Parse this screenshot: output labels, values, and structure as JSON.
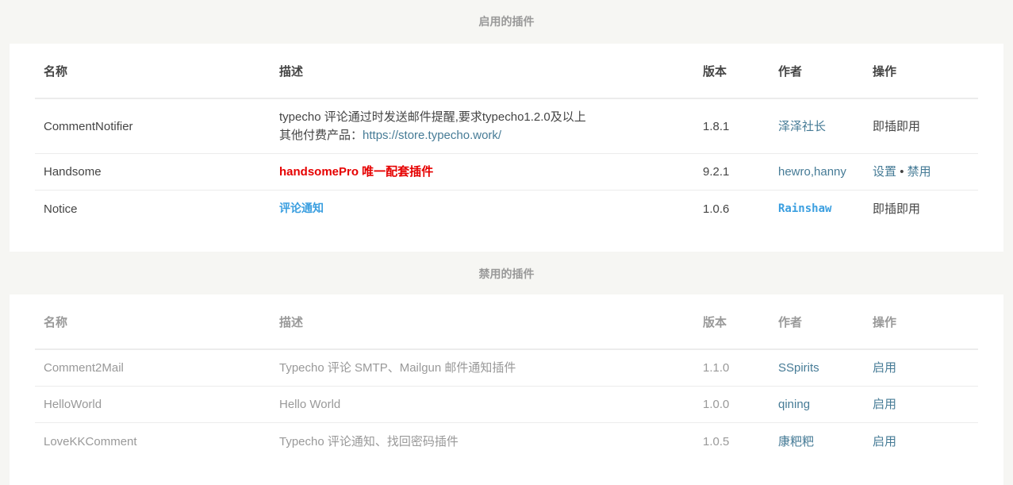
{
  "enabled": {
    "title": "启用的插件",
    "headers": {
      "name": "名称",
      "desc": "描述",
      "version": "版本",
      "author": "作者",
      "action": "操作"
    },
    "rows": [
      {
        "name": "CommentNotifier",
        "desc_line1": "typecho 评论通过时发送邮件提醒,要求typecho1.2.0及以上",
        "desc_line2_prefix": "其他付费产品：",
        "desc_line2_link": "https://store.typecho.work/",
        "version": "1.8.1",
        "author": "泽泽社长",
        "action": "即插即用"
      },
      {
        "name": "Handsome",
        "desc": "handsomePro 唯一配套插件",
        "version": "9.2.1",
        "author": "hewro,hanny",
        "action_settings": "设置",
        "action_sep": "•",
        "action_disable": "禁用"
      },
      {
        "name": "Notice",
        "desc": "评论通知",
        "version": "1.0.6",
        "author": "Rainshaw",
        "action": "即插即用"
      }
    ]
  },
  "disabled": {
    "title": "禁用的插件",
    "headers": {
      "name": "名称",
      "desc": "描述",
      "version": "版本",
      "author": "作者",
      "action": "操作"
    },
    "rows": [
      {
        "name": "Comment2Mail",
        "desc": "Typecho 评论 SMTP、Mailgun 邮件通知插件",
        "version": "1.1.0",
        "author": "SSpirits",
        "action": "启用"
      },
      {
        "name": "HelloWorld",
        "desc": "Hello World",
        "version": "1.0.0",
        "author": "qining",
        "action": "启用"
      },
      {
        "name": "LoveKKComment",
        "desc": "Typecho 评论通知、找回密码插件",
        "version": "1.0.5",
        "author": "康粑粑",
        "action": "启用"
      }
    ]
  },
  "colors": {
    "link": "#467b96",
    "red": "#e60000",
    "blue": "#3b9fe0",
    "background": "#f6f6f3"
  }
}
